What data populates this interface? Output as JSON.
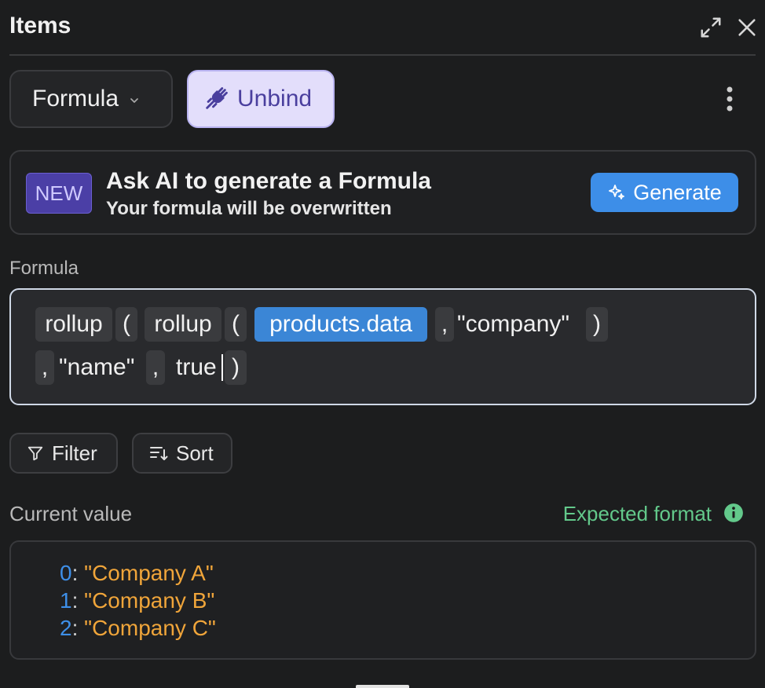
{
  "header": {
    "title": "Items"
  },
  "toolbar": {
    "formula_label": "Formula",
    "unbind_label": "Unbind"
  },
  "ai_card": {
    "badge": "NEW",
    "title": "Ask AI to generate a Formula",
    "subtitle": "Your formula will be overwritten",
    "generate_label": "Generate"
  },
  "formula": {
    "label": "Formula",
    "tokens": {
      "fn1": "rollup",
      "paren1": "(",
      "fn2": "rollup",
      "paren2": "(",
      "ref": "products.data",
      "comma1": ",",
      "arg1": "\"company\"",
      "close1": ")",
      "comma2": ",",
      "arg2": "\"name\"",
      "comma3": ",",
      "arg3": "true",
      "close2": ")"
    }
  },
  "controls": {
    "filter_label": "Filter",
    "sort_label": "Sort"
  },
  "current_value": {
    "label": "Current value",
    "expected_format_label": "Expected format",
    "items": [
      {
        "key": "0",
        "value": "\"Company A\""
      },
      {
        "key": "1",
        "value": "\"Company B\""
      },
      {
        "key": "2",
        "value": "\"Company C\""
      }
    ]
  },
  "colors": {
    "background": "#1c1d1e",
    "accent_blue": "#3d8ee8",
    "unbind_bg": "#e3defb",
    "unbind_text": "#4a3f9e",
    "badge_bg": "#4b3fa6",
    "expected_format_green": "#63c98b",
    "value_orange": "#f0a53a"
  },
  "icons": {
    "expand": "expand-icon",
    "close": "close-icon",
    "chevron": "chevron-down-icon",
    "unbind": "unplug-icon",
    "more": "more-vertical-icon",
    "sparkle": "sparkle-icon",
    "filter": "filter-icon",
    "sort": "sort-icon",
    "info": "info-icon"
  }
}
